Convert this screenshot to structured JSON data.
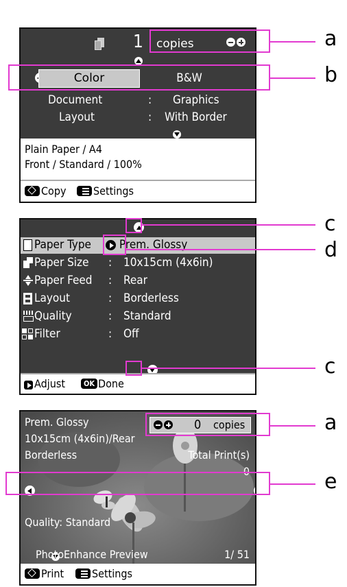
{
  "screen1": {
    "copies_count": "1",
    "copies_label": "copies",
    "mode_color": "Color",
    "mode_bw": "B&W",
    "rows": [
      {
        "label": "Document",
        "sep": ":",
        "value": "Graphics"
      },
      {
        "label": "Layout",
        "sep": ":",
        "value": "With Border"
      }
    ],
    "info_line1": "Plain Paper / A4",
    "info_line2": "Front / Standard / 100%",
    "footer_copy": "Copy",
    "footer_settings": "Settings"
  },
  "screen2": {
    "rows": [
      {
        "label": "Paper Type",
        "sep": "",
        "value": "Prem. Glossy",
        "icon": "paper-type-icon"
      },
      {
        "label": "Paper Size",
        "sep": ":",
        "value": "10x15cm (4x6in)",
        "icon": "paper-size-icon"
      },
      {
        "label": "Paper Feed",
        "sep": ":",
        "value": "Rear",
        "icon": "paper-feed-icon"
      },
      {
        "label": "Layout",
        "sep": ":",
        "value": "Borderless",
        "icon": "layout-icon"
      },
      {
        "label": "Quality",
        "sep": ":",
        "value": "Standard",
        "icon": "quality-icon"
      },
      {
        "label": "Filter",
        "sep": ":",
        "value": "Off",
        "icon": "filter-icon"
      }
    ],
    "footer_adjust": "Adjust",
    "footer_ok": "OK",
    "footer_done": "Done"
  },
  "screen3": {
    "paper_type": "Prem. Glossy",
    "paper_size_feed": "10x15cm (4x6in)/Rear",
    "layout": "Borderless",
    "copies_count": "0",
    "copies_label": "copies",
    "total_prints_label": "Total Print(s)",
    "total_prints_value": "0",
    "quality": "Quality: Standard",
    "photoenhance": "PhotoEnhance Preview",
    "photo_counter": "1/ 51",
    "footer_print": "Print",
    "footer_settings": "Settings"
  },
  "callouts": {
    "a1": "a",
    "b": "b",
    "c1": "c",
    "d": "d",
    "c2": "c",
    "a2": "a",
    "e": "e"
  },
  "colors": {
    "lcd_background": "#3b3b3b",
    "callout_magenta": "#e23ad0",
    "selected_tab": "#c8c8c8",
    "highlight_row": "#c8c8c8"
  }
}
